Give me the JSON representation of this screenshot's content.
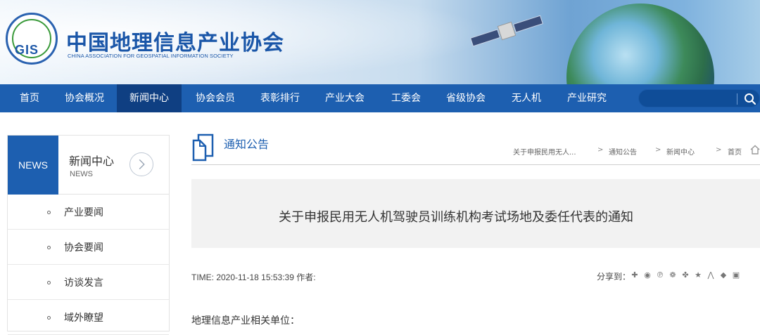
{
  "header": {
    "logo_text": "GIS",
    "title": "中国地理信息产业协会",
    "subtitle": "CHINA ASSOCIATION FOR GEOSPATIAL INFORMATION SOCIETY"
  },
  "nav": {
    "items": [
      {
        "label": "首页"
      },
      {
        "label": "协会概况"
      },
      {
        "label": "新闻中心",
        "active": true
      },
      {
        "label": "协会会员"
      },
      {
        "label": "表彰排行"
      },
      {
        "label": "产业大会"
      },
      {
        "label": "工委会"
      },
      {
        "label": "省级协会"
      },
      {
        "label": "无人机"
      },
      {
        "label": "产业研究"
      }
    ],
    "search": {
      "placeholder": "",
      "icon": "search-icon"
    }
  },
  "sidebar": {
    "tag": "NEWS",
    "title": "新闻中心",
    "title_en": "NEWS",
    "items": [
      {
        "label": "产业要闻"
      },
      {
        "label": "协会要闻"
      },
      {
        "label": "访谈发言"
      },
      {
        "label": "域外瞭望"
      }
    ]
  },
  "section": {
    "title": "通知公告",
    "breadcrumb": [
      "关于申报民用无人...",
      "通知公告",
      "新闻中心",
      "首页"
    ]
  },
  "article": {
    "title": "关于申报民用无人机驾驶员训练机构考试场地及委任代表的通知",
    "meta": "TIME: 2020-11-18 15:53:39 作者:",
    "share_label": "分享到：",
    "body_start": "地理信息产业相关单位："
  },
  "colors": {
    "primary": "#1d5fb0",
    "nav_active": "#0f3f82"
  }
}
